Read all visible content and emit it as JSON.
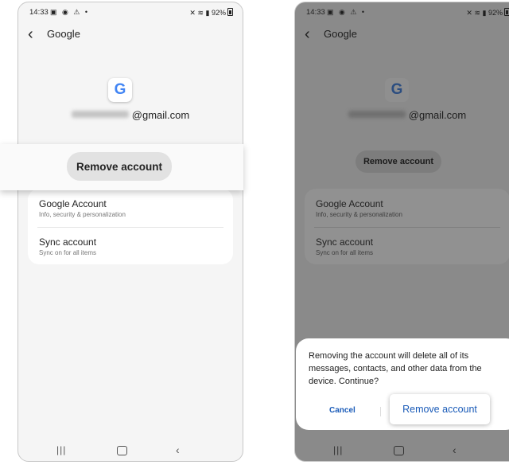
{
  "status_bar": {
    "time": "14:33",
    "battery": "92%"
  },
  "header": {
    "title": "Google"
  },
  "account": {
    "email_domain": "@gmail.com"
  },
  "actions": {
    "remove_account": "Remove account"
  },
  "menu": {
    "items": [
      {
        "title": "Google Account",
        "subtitle": "Info, security & personalization"
      },
      {
        "title": "Sync account",
        "subtitle": "Sync on for all items"
      }
    ]
  },
  "dialog": {
    "message": "Removing the account will delete all of its messages, contacts, and other data from the device. Continue?",
    "cancel_label": "Cancel",
    "confirm_label": "Remove account"
  },
  "icons": {
    "google_logo": "G",
    "back": "chevron-left-icon",
    "nav": [
      "recent-apps-icon",
      "home-icon",
      "back-icon"
    ]
  },
  "colors": {
    "google_blue": "#4285F4",
    "link_blue": "#1a5bb8",
    "dim_overlay": "#8a8a8a"
  }
}
